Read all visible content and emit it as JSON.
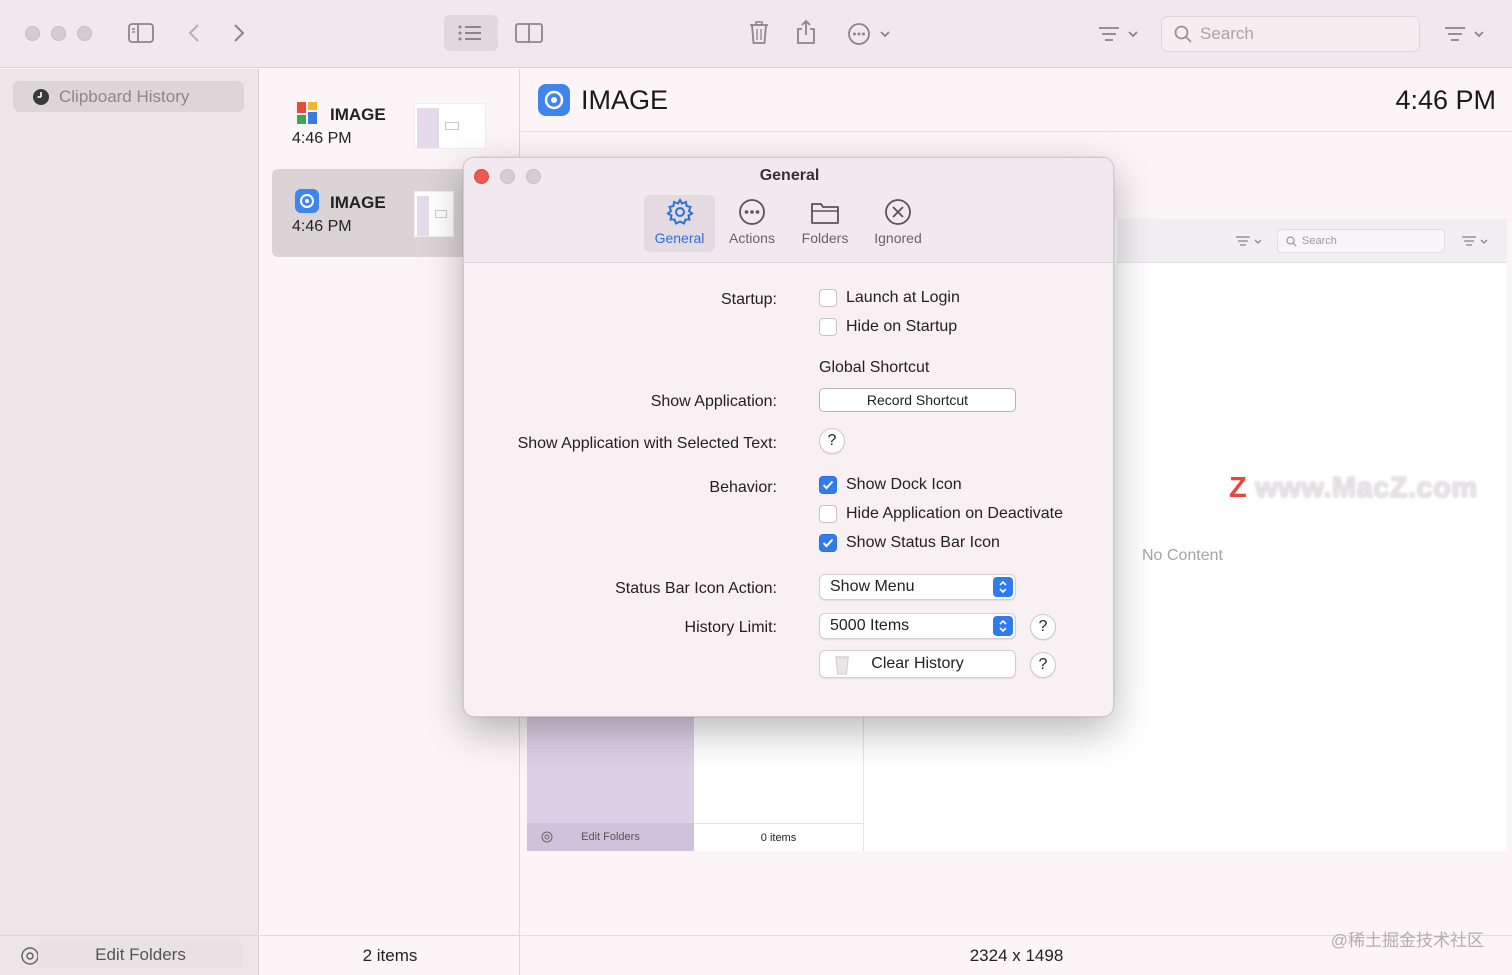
{
  "toolbar": {
    "search_placeholder": "Search"
  },
  "sidebar": {
    "items": [
      {
        "label": "Clipboard History"
      }
    ],
    "footer": {
      "edit_label": "Edit Folders"
    }
  },
  "list": {
    "items": [
      {
        "title": "IMAGE",
        "time": "4:46 PM",
        "icon": "colorful-logo-icon"
      },
      {
        "title": "IMAGE",
        "time": "4:46 PM",
        "icon": "app-gear-icon"
      }
    ],
    "footer": {
      "count": "2 items"
    }
  },
  "detail": {
    "title": "IMAGE",
    "time": "4:46 PM",
    "no_content": "No Content",
    "dimensions": "2324 x 1498",
    "preview": {
      "search_placeholder": "Search",
      "edit_folders": "Edit Folders",
      "items_count": "0 items"
    },
    "watermark": "www.MacZ.com",
    "watermark_z": "Z",
    "cn_mark": "@稀土掘金技术社区"
  },
  "modal": {
    "title": "General",
    "tabs": [
      {
        "label": "General",
        "icon": "gear-icon",
        "active": true
      },
      {
        "label": "Actions",
        "icon": "ellipsis-circle-icon"
      },
      {
        "label": "Folders",
        "icon": "folder-icon"
      },
      {
        "label": "Ignored",
        "icon": "x-circle-icon"
      }
    ],
    "startup_label": "Startup:",
    "launch_at_login": {
      "label": "Launch at Login",
      "checked": false
    },
    "hide_on_startup": {
      "label": "Hide on Startup",
      "checked": false
    },
    "global_shortcut": "Global Shortcut",
    "show_application_label": "Show Application:",
    "record_shortcut": "Record Shortcut",
    "show_selected_label": "Show Application with Selected Text:",
    "help_glyph": "?",
    "behavior_label": "Behavior:",
    "show_dock_icon": {
      "label": "Show Dock Icon",
      "checked": true
    },
    "hide_on_deactivate": {
      "label": "Hide Application on Deactivate",
      "checked": false
    },
    "show_status_bar_icon": {
      "label": "Show Status Bar Icon",
      "checked": true
    },
    "status_action_label": "Status Bar Icon Action:",
    "status_action_value": "Show Menu",
    "history_limit_label": "History Limit:",
    "history_limit_value": "5000 Items",
    "clear_history": "Clear History"
  },
  "colors": {
    "accent": "#2f7bf0",
    "close_red": "#ee5a52"
  }
}
